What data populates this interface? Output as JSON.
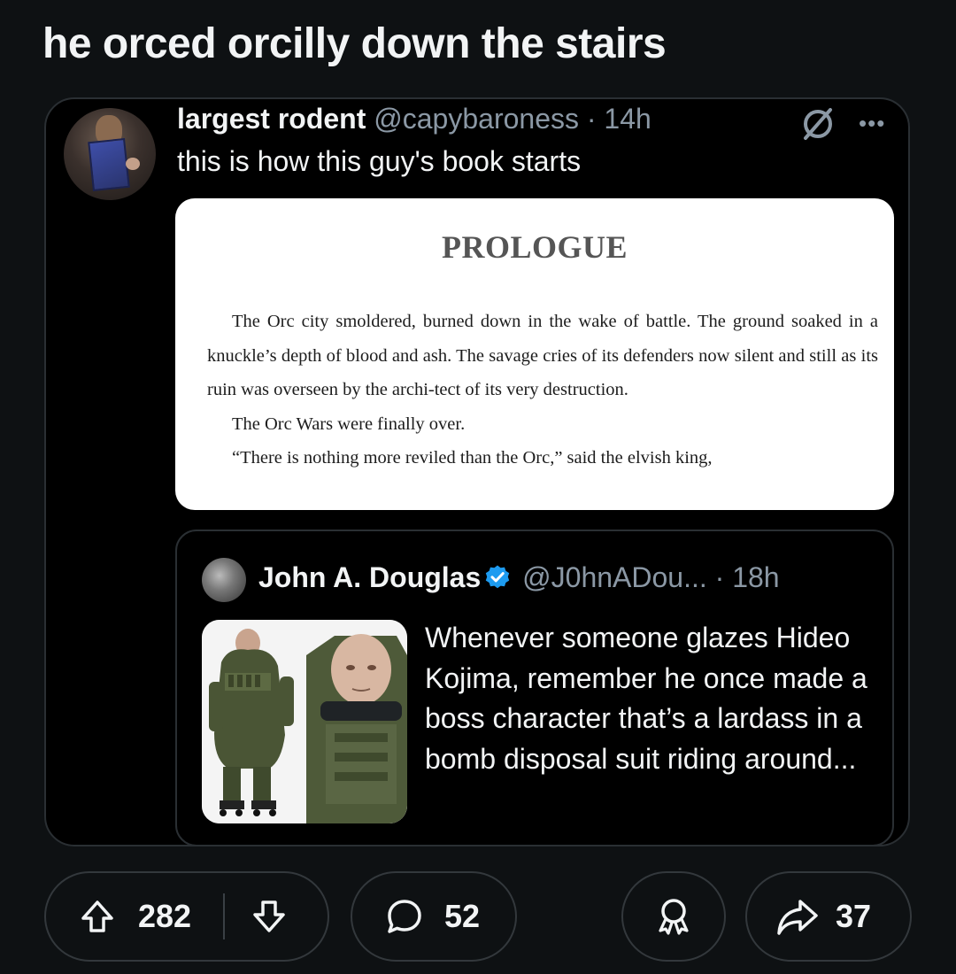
{
  "post": {
    "title": "he orced orcilly down the stairs"
  },
  "tweet": {
    "display_name": "largest rodent",
    "handle": "@capybaroness",
    "separator": "·",
    "time": "14h",
    "text": "this is how this guy's book starts",
    "avatar_icon": "user-avatar",
    "null_icon": "no-entry-icon",
    "more_icon": "more-options-icon"
  },
  "book_page": {
    "heading": "PROLOGUE",
    "paragraphs": [
      "The Orc city smoldered, burned down in the wake of battle. The ground soaked in a knuckle’s depth of blood and ash. The savage cries of its defenders now silent and still as its ruin was overseen by the archi-tect of its very destruction.",
      "The Orc Wars were finally over.",
      "“There is nothing more reviled than the Orc,” said the elvish king,"
    ]
  },
  "quoted_tweet": {
    "display_name": "John A. Douglas",
    "verified": true,
    "handle": "@J0hnADou...",
    "separator": "·",
    "time": "18h",
    "text": "Whenever someone glazes Hideo Kojima, remember he once made a boss character that’s a lardass in a bomb disposal suit riding around...",
    "verified_color": "#1d9bf0"
  },
  "actions": {
    "upvotes": "282",
    "comments": "52",
    "shares": "37",
    "icons": [
      "upvote-icon",
      "downvote-icon",
      "comment-icon",
      "award-icon",
      "share-icon"
    ]
  },
  "colors": {
    "background": "#0e1113",
    "card": "#000000",
    "muted_text": "#8b98a5",
    "text": "#f2f4f5",
    "border": "#2a2f33"
  }
}
